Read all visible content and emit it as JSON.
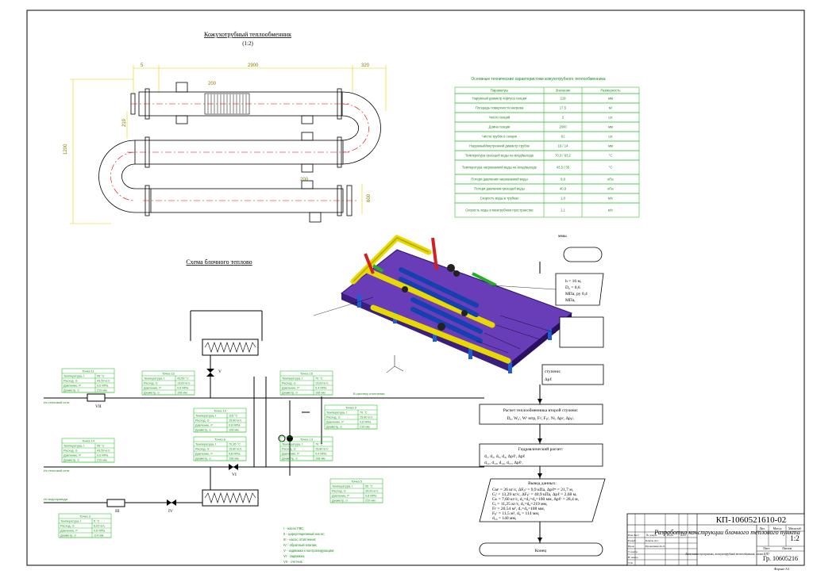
{
  "drawing": {
    "heat_exchanger_title": "Кожухотрубный теплообменник",
    "heat_exchanger_scale": "(1:2)",
    "scheme_title": "Схема блочного теплово",
    "dimensions": {
      "d_top_a": "5",
      "d_top_b": "2900",
      "d_top_c": "320",
      "d_left": "1200",
      "d_200_a": "200",
      "d_200_b": "200",
      "d_219": "219",
      "d_600": "600"
    }
  },
  "spec_table": {
    "caption": "Основные технические характеристики кожухотрубного теплообменника",
    "headers": [
      "Параметры",
      "Значение",
      "Размерность"
    ],
    "rows": [
      [
        "Наружный диаметр корпуса секции",
        "219",
        "мм"
      ],
      [
        "Площадь поверхности нагрева",
        "17,5",
        "м²"
      ],
      [
        "Число секций",
        "2",
        "шт"
      ],
      [
        "Длина секции",
        "2000",
        "мм"
      ],
      [
        "Число трубок в секции",
        "61",
        "шт"
      ],
      [
        "Наружный/внутренний диаметр трубок",
        "16 / 14",
        "мм"
      ],
      [
        "Температура греющей воды на вход/выходе",
        "70,3 / 63,2",
        "°С"
      ],
      [
        "Температура нагреваемой воды на вход/выходе",
        "43,5 / 55",
        "°С"
      ],
      [
        "Потери давления нагреваемой воды",
        "9,9",
        "кПа"
      ],
      [
        "Потери давления греющей воды",
        "40,9",
        "кПа"
      ],
      [
        "Скорость воды в трубках",
        "1,0",
        "м/с"
      ],
      [
        "Скорость воды в межтрубном пространстве",
        "1,1",
        "м/с"
      ]
    ]
  },
  "scheme": {
    "points": [
      {
        "title": "Точка 11",
        "r1": "Температура, t",
        "v1": "55 °С",
        "r2": "Расход, G",
        "v2": "43,59 кг/с",
        "r3": "Давление, P",
        "v3": "0,6 МПа",
        "r4": "Диаметр, d",
        "v4": "219 мм"
      },
      {
        "title": "Точка 12",
        "r1": "Температура, t",
        "v1": "43,59 °С",
        "r2": "Расход, G",
        "v2": "13,63 кг/с",
        "r3": "Давление, P",
        "v3": "0,6 МПа",
        "r4": "Диаметр, d",
        "v4": "108 мм"
      },
      {
        "title": "Точка 14",
        "r1": "Температура, t",
        "v1": "55 °С",
        "r2": "Расход, G",
        "v2": "43,59 кг/с",
        "r3": "Давление, P",
        "v3": "0,6 МПа",
        "r4": "Диаметр, d",
        "v4": "219 мм"
      },
      {
        "title": "Точка 10",
        "r1": "Температура, t",
        "v1": "115 °С",
        "r2": "Расход, G",
        "v2": "15,80 кг/с",
        "r3": "Давление, P",
        "v3": "0,8 МПа",
        "r4": "Диаметр, d",
        "v4": "108 мм"
      },
      {
        "title": "Точка 8",
        "r1": "Температура, t",
        "v1": "70,35 °С",
        "r2": "Расход, G",
        "v2": "15,80 кг/с",
        "r3": "Давление, P",
        "v3": "0,8 МПа",
        "r4": "Диаметр, d",
        "v4": "108 мм"
      },
      {
        "title": "Точка 3",
        "r1": "Температура, t",
        "v1": "5 °С",
        "r2": "Расход, G",
        "v2": "6,63 кг/с",
        "r3": "Давление, P",
        "v3": "0,6 МПа",
        "r4": "Диаметр, d",
        "v4": "114 мм"
      },
      {
        "title": "Точка 15",
        "r1": "Температура, t",
        "v1": "70 °С",
        "r2": "Расход, G",
        "v2": "13,63 кг/с",
        "r3": "Давление, P",
        "v3": "0,4 МПа",
        "r4": "Диаметр, d",
        "v4": "108 мм"
      },
      {
        "title": "Точка 13",
        "r1": "Температура, t",
        "v1": "70 °С",
        "r2": "Расход, G",
        "v2": "15,80 кг/с",
        "r3": "Давление, P",
        "v3": "0,4 МПа",
        "r4": "Диаметр, d",
        "v4": "108 мм"
      },
      {
        "title": "Точка 9",
        "r1": "Температура, t",
        "v1": "70 °С",
        "r2": "Расход, G",
        "v2": "15,80 кг/с",
        "r3": "Давление, P",
        "v3": "0,8 МПа",
        "r4": "Диаметр, d",
        "v4": "219 мм"
      },
      {
        "title": "Точка 5",
        "r1": "Температура, t",
        "v1": "55 °С",
        "r2": "Расход, G",
        "v2": "33,99 кг/с",
        "r3": "Давление, P",
        "v3": "0,8 МПа",
        "r4": "Диаметр, d",
        "v4": "219 мм"
      }
    ],
    "line_labels": {
      "l1": "Из тепловой сети",
      "l2": "Из тепловой сети",
      "l3": "Из водопровода",
      "l4": "В систему отопления"
    },
    "valve_labels": {
      "v7": "VII",
      "v6": "VI",
      "v4": "IV",
      "v3": "III",
      "v5": "V"
    },
    "legend": [
      "I - насос ГВС;",
      "II - циркуляционный насос;",
      "III - насос отопления;",
      "IV - обратный клапан;",
      "V - задвижка к контролирующим;",
      "VI - задвижка;",
      "VII - счетчик."
    ]
  },
  "flowchart": {
    "title_frag": "ммы",
    "b1": "h = 16 м,",
    "b1b": "D₀ = 0,6",
    "b1c": "МПа, pу 0,4",
    "b1d": "МПа,",
    "b2_label": "ступени:",
    "b2b": "Δpℓ",
    "step1": "Расчет теплообменника второй ступени:",
    "step1b": "D₀, W₀ᵗ, Wᵗ мтр, Fₗᵗ, Fₚᵗ, Nₗ, Δpₗᵗ, Δpₚᵗ.",
    "step2": "Гидравлический расчет:",
    "step2b": "d₁,   d₂,   d₃,   d₄,   Δpℓᵗ,   Δpℓ",
    "step2c": "d₁₂,   d₁₃,   d₁₄,   d₁₅,   Δpℓᵗ,",
    "result_title": "Вывод данных:",
    "result": [
      "Gмᵗ = 26 кг/с,    ΔFₚᵗ = 9,9 кПа,    Δpℓᵐ = 21,7 м,",
      "Gᵢᵗ = 13,29 кг/с,   ΔFₚᵗ = 40,9 кПа,   Δpℓ = 2,68 м,",
      "Gₕ = 7,60 кг/с,    d₂=d₃=d₄=100 мм,  Δpℓᵗ = 28,4 м,",
      "Gᵢ = 11,25 кг/с,    d₅=d₆=219 мм,",
      "Fₗᵗ = 20,54 м²,    d₇=d₈=108 мм,",
      "Fₚᵗ = 11,5 м²,     d₉ = 114 мм,",
      "                    d₁₀ = 140 мм,"
    ],
    "end": "Конец"
  },
  "title_block": {
    "code": "КП-1060521610-02",
    "description": "Разработка конструкции блочного теплового пункта",
    "sub": "Блок-схема программы, кожухотрубный теплообменник, схема БТП",
    "scale": "1:2",
    "group": "Гр. 10605216",
    "format": "Формат А3",
    "col_lit": "Лит.",
    "col_mass": "Масса",
    "col_scale": "Масштаб",
    "col_sheet": "Лист",
    "col_sheets": "Листов",
    "rows": [
      "Изм Лист",
      "Разраб.",
      "Пров.",
      "Т. контр.",
      "Н. контр.",
      "Утв."
    ],
    "people": [
      "Коваль Д.С.",
      "Прокопенко И.Л."
    ],
    "h_ndoc": "№ докум.",
    "h_sign": "Подп.",
    "h_date": "Дата"
  }
}
